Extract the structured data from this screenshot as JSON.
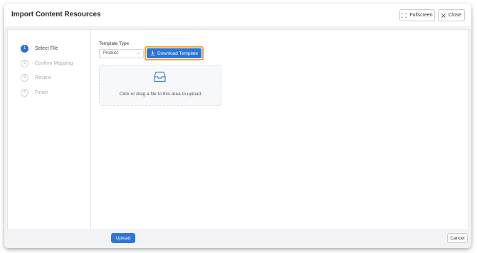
{
  "dialog": {
    "title": "Import Content Resources",
    "fullscreen_label": "Fullscreen",
    "close_label": "Close"
  },
  "steps": [
    {
      "number": "1",
      "label": "Select File",
      "active": true
    },
    {
      "number": "2",
      "label": "Confirm Mapping",
      "active": false
    },
    {
      "number": "3",
      "label": "Review",
      "active": false
    },
    {
      "number": "4",
      "label": "Finish",
      "active": false
    }
  ],
  "form": {
    "template_type_label": "Template Type",
    "template_type_value": "Product",
    "download_template_label": "Download Template"
  },
  "dropzone": {
    "text": "Click or drag a file to this area to upload",
    "icon": "inbox-icon"
  },
  "footer": {
    "upload_label": "Upload",
    "cancel_label": "Cancel"
  },
  "colors": {
    "primary": "#2f75d6",
    "highlight": "#f0a43a",
    "active_step": "#2d6ed8"
  }
}
